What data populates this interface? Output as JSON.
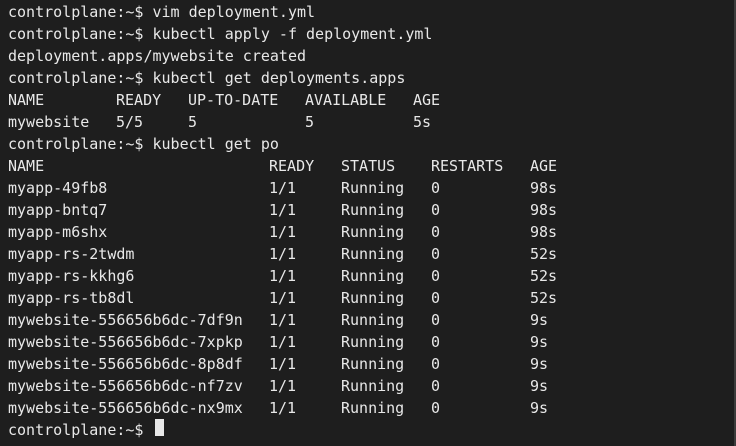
{
  "terminal": {
    "lines": {
      "l0": "controlplane:~$ vim deployment.yml",
      "l1": "controlplane:~$ kubectl apply -f deployment.yml",
      "l2": "deployment.apps/mywebsite created",
      "l3": "controlplane:~$ kubectl get deployments.apps",
      "l6": "controlplane:~$ kubectl get po",
      "prompt": "controlplane:~$ "
    },
    "deploy_table": {
      "headers": [
        "NAME",
        "READY",
        "UP-TO-DATE",
        "AVAILABLE",
        "AGE"
      ],
      "rows": [
        [
          "mywebsite",
          "5/5",
          "5",
          "5",
          "5s"
        ]
      ]
    },
    "pod_table": {
      "headers": [
        "NAME",
        "READY",
        "STATUS",
        "RESTARTS",
        "AGE"
      ],
      "rows": [
        [
          "myapp-49fb8",
          "1/1",
          "Running",
          "0",
          "98s"
        ],
        [
          "myapp-bntq7",
          "1/1",
          "Running",
          "0",
          "98s"
        ],
        [
          "myapp-m6shx",
          "1/1",
          "Running",
          "0",
          "98s"
        ],
        [
          "myapp-rs-2twdm",
          "1/1",
          "Running",
          "0",
          "52s"
        ],
        [
          "myapp-rs-kkhg6",
          "1/1",
          "Running",
          "0",
          "52s"
        ],
        [
          "myapp-rs-tb8dl",
          "1/1",
          "Running",
          "0",
          "52s"
        ],
        [
          "mywebsite-556656b6dc-7df9n",
          "1/1",
          "Running",
          "0",
          "9s"
        ],
        [
          "mywebsite-556656b6dc-7xpkp",
          "1/1",
          "Running",
          "0",
          "9s"
        ],
        [
          "mywebsite-556656b6dc-8p8df",
          "1/1",
          "Running",
          "0",
          "9s"
        ],
        [
          "mywebsite-556656b6dc-nf7zv",
          "1/1",
          "Running",
          "0",
          "9s"
        ],
        [
          "mywebsite-556656b6dc-nx9mx",
          "1/1",
          "Running",
          "0",
          "9s"
        ]
      ]
    }
  }
}
